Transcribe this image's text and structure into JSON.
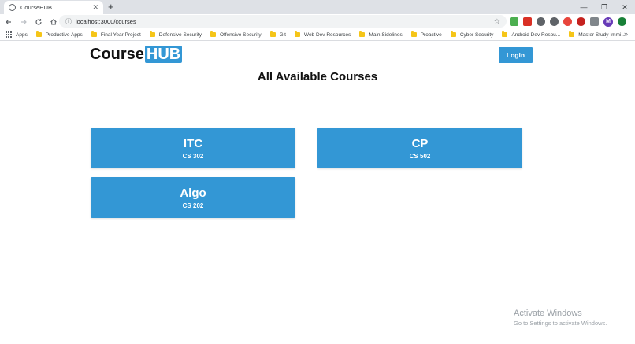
{
  "browser": {
    "tab_title": "CourseHUB",
    "tab_close": "✕",
    "new_tab": "+",
    "win_minimize": "—",
    "win_restore": "❐",
    "win_close": "✕",
    "url": "localhost:3000/courses",
    "profile_initial": "M",
    "bookmarks": [
      {
        "label": "Apps",
        "type": "apps"
      },
      {
        "label": "Productive Apps",
        "type": "folder"
      },
      {
        "label": "Final Year Project",
        "type": "folder"
      },
      {
        "label": "Defensive Security",
        "type": "folder"
      },
      {
        "label": "Offensive Security",
        "type": "folder"
      },
      {
        "label": "Git",
        "type": "folder"
      },
      {
        "label": "Web Dev Resources",
        "type": "folder"
      },
      {
        "label": "Main Sidelines",
        "type": "folder"
      },
      {
        "label": "Proactive",
        "type": "folder"
      },
      {
        "label": "Cyber Security",
        "type": "folder"
      },
      {
        "label": "Android Dev Resou...",
        "type": "folder"
      },
      {
        "label": "Master Study Immi...",
        "type": "folder"
      }
    ],
    "bookmarks_more": "»"
  },
  "header": {
    "logo_course": "Course",
    "logo_hub": "HUB",
    "login_label": "Login"
  },
  "main": {
    "title": "All Available Courses",
    "courses": [
      {
        "name": "ITC",
        "code": "CS 302"
      },
      {
        "name": "CP",
        "code": "CS 502"
      },
      {
        "name": "Algo",
        "code": "CS 202"
      }
    ]
  },
  "watermark": {
    "title": "Activate Windows",
    "subtitle": "Go to Settings to activate Windows."
  },
  "colors": {
    "accent": "#3397d5",
    "tabstrip": "#dee1e6"
  }
}
